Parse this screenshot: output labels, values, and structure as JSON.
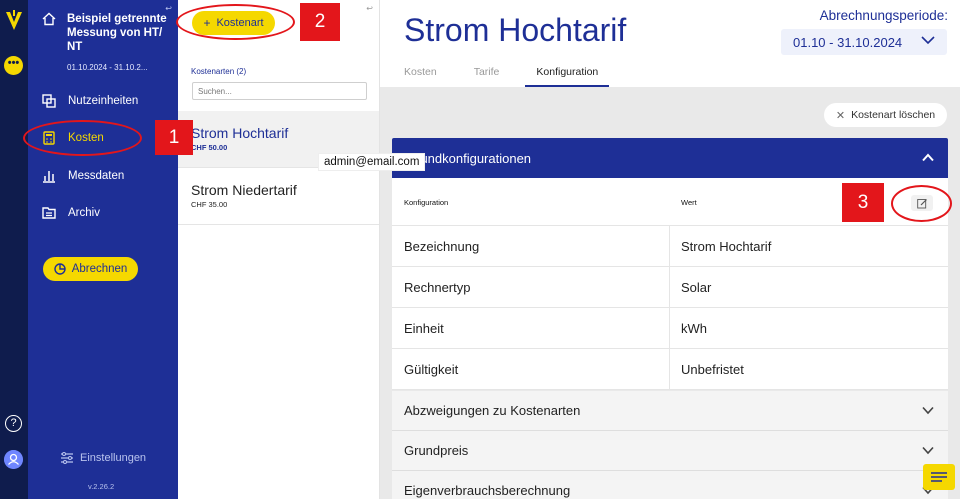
{
  "rail": {
    "logo_icon": "v-logo-icon",
    "more_icon": "ellipsis-icon",
    "more_label": "•••",
    "help_icon": "help-icon",
    "help_label": "?",
    "user_icon": "user-icon"
  },
  "nav": {
    "project_name": "Beispiel getrennte Messung von HT/ NT",
    "project_period": "01.10.2024 - 31.10.2...",
    "items": [
      {
        "label": "Nutzeinheiten",
        "icon": "units-icon"
      },
      {
        "label": "Kosten",
        "icon": "calculator-icon"
      },
      {
        "label": "Messdaten",
        "icon": "bar-chart-icon"
      },
      {
        "label": "Archiv",
        "icon": "archive-icon"
      }
    ],
    "bill_button": "Abrechnen",
    "settings_label": "Einstellungen",
    "version": "v.2.26.2"
  },
  "list": {
    "add_button": "Kostenart",
    "count_label": "Kostenarten (2)",
    "search_placeholder": "Suchen...",
    "items": [
      {
        "title": "Strom Hochtarif",
        "price": "CHF 50.00"
      },
      {
        "title": "Strom Niedertarif",
        "price": "CHF 35.00"
      }
    ]
  },
  "tooltip": "admin@email.com",
  "main": {
    "title": "Strom Hochtarif",
    "period_label": "Abrechnungsperiode:",
    "period_value": "01.10 - 31.10.2024",
    "tabs": [
      "Kosten",
      "Tarife",
      "Konfiguration"
    ],
    "delete_button": "Kostenart löschen",
    "section_title": "Grundkonfigurationen",
    "table": {
      "col_config": "Konfiguration",
      "col_value": "Wert",
      "rows": [
        {
          "key": "Bezeichnung",
          "value": "Strom Hochtarif"
        },
        {
          "key": "Rechnertyp",
          "value": "Solar"
        },
        {
          "key": "Einheit",
          "value": "kWh"
        },
        {
          "key": "Gültigkeit",
          "value": "Unbefristet"
        }
      ]
    },
    "accordions": [
      "Abzweigungen zu Kostenarten",
      "Grundpreis",
      "Eigenverbrauchsberechnung"
    ]
  },
  "annotations": {
    "n1": "1",
    "n2": "2",
    "n3": "3",
    "color": "#e3161b"
  },
  "colors": {
    "brand_blue": "#1e2f96",
    "accent_yellow": "#f5d800",
    "rail_dark": "#0f1c4d"
  }
}
